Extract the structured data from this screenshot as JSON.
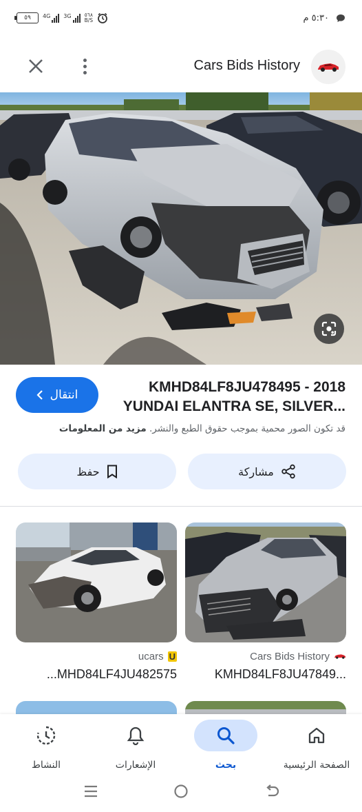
{
  "status_bar": {
    "time": "٥:٣٠ م",
    "battery": "٥٩",
    "net1": "4G",
    "net2": "3G",
    "speed_value": "٥٦٨",
    "speed_unit": "B/S"
  },
  "header": {
    "title": "Cars Bids History"
  },
  "result": {
    "title_line1": "KMHD84LF8JU478495 - 2018",
    "title_line2": "...YUNDAI ELANTRA SE, SILVER",
    "visit_label": "انتقال",
    "copyright_text": "قد تكون الصور محمية بموجب حقوق الطبع والنشر.",
    "more_info_label": "مزيد من المعلومات",
    "save_label": "حفظ",
    "share_label": "مشاركة"
  },
  "related": [
    {
      "source": "ucars",
      "source_icon_letter": "U",
      "title": "...MHD84LF4JU482575"
    },
    {
      "source": "Cars Bids History",
      "title": "KMHD84LF8JU47849..."
    }
  ],
  "bottom_nav": {
    "home": "الصفحة الرئيسية",
    "search": "بحث",
    "notifications": "الإشعارات",
    "activity": "النشاط"
  },
  "colors": {
    "accent": "#1a73e8",
    "pill": "#e8f0fe",
    "nav_active": "#d3e3fd"
  }
}
